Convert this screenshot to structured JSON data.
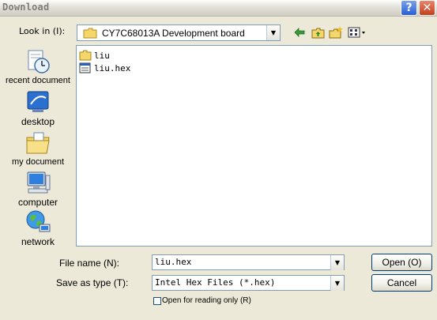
{
  "window": {
    "title": "Download",
    "help_glyph": "?",
    "close_glyph": "✕"
  },
  "lookin": {
    "label": "Look in (I):",
    "value": "CY7C68013A Development board"
  },
  "toolbar": {
    "icons": [
      "back-arrow-icon",
      "up-folder-icon",
      "new-folder-icon",
      "view-menu-icon"
    ]
  },
  "places": [
    {
      "label": "recent document",
      "icon": "recent-documents-icon"
    },
    {
      "label": "desktop",
      "icon": "desktop-icon"
    },
    {
      "label": "my document",
      "icon": "my-documents-icon"
    },
    {
      "label": "computer",
      "icon": "computer-icon"
    },
    {
      "label": "network",
      "icon": "network-icon"
    }
  ],
  "files": [
    {
      "name": "liu",
      "icon": "folder-icon"
    },
    {
      "name": "liu.hex",
      "icon": "hex-file-icon"
    }
  ],
  "filename": {
    "label": "File name (N):",
    "value": "liu.hex"
  },
  "filetype": {
    "label": "Save as type (T):",
    "value": "Intel Hex Files (*.hex)"
  },
  "readonly": {
    "label": "Open for reading only (R)",
    "checked": false
  },
  "buttons": {
    "open": "Open (O)",
    "cancel": "Cancel"
  },
  "colors": {
    "dialog_bg": "#ece9d8",
    "field_border": "#7f9db9",
    "button_border": "#003c74"
  }
}
